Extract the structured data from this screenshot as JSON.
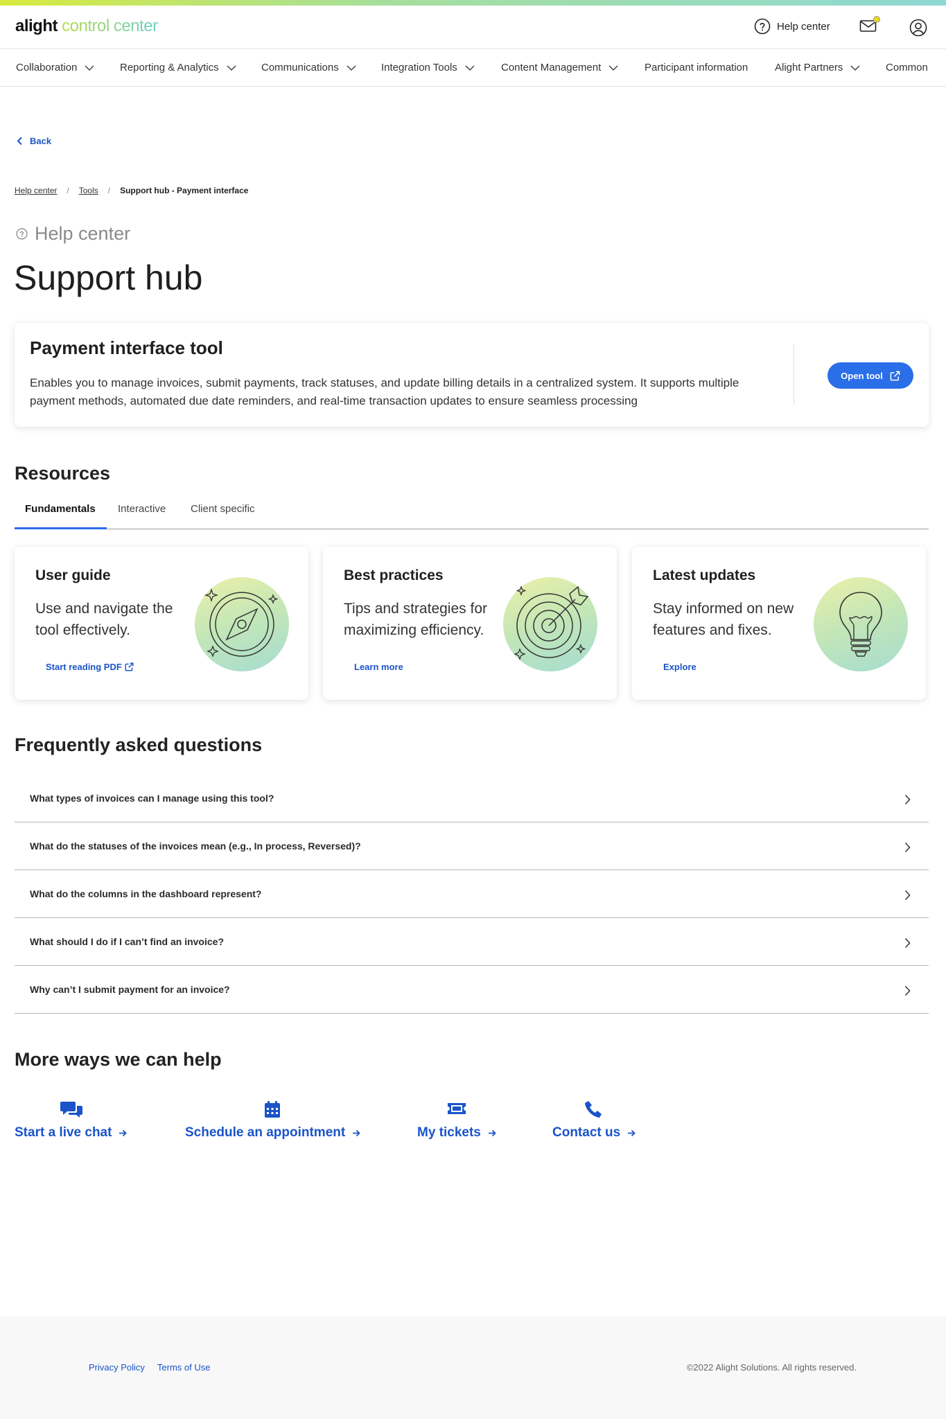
{
  "header": {
    "logo_brand": "alight",
    "logo_suffix": "control center",
    "help_label": "Help center"
  },
  "nav": {
    "items": [
      {
        "label": "Collaboration"
      },
      {
        "label": "Reporting & Analytics"
      },
      {
        "label": "Communications"
      },
      {
        "label": "Integration Tools"
      },
      {
        "label": "Content Management"
      },
      {
        "label": "Participant information"
      },
      {
        "label": "Alight Partners"
      },
      {
        "label": "Common"
      }
    ]
  },
  "back_label": "Back",
  "breadcrumb": {
    "items": [
      "Help center",
      "Tools"
    ],
    "separator": "/",
    "current": "Support hub - Payment interface"
  },
  "eyebrow": "Help center",
  "page_title": "Support hub",
  "tool": {
    "title": "Payment interface tool",
    "description": "Enables you to manage invoices, submit payments, track statuses, and update billing details in a centralized system. It supports multiple payment methods, automated due date reminders, and real-time transaction updates to ensure seamless processing",
    "button_label": "Open tool"
  },
  "resources": {
    "heading": "Resources",
    "tabs": [
      {
        "label": "Fundamentals",
        "active": true
      },
      {
        "label": "Interactive"
      },
      {
        "label": "Client specific"
      }
    ],
    "cards": [
      {
        "title": "User guide",
        "description": "Use and navigate the tool effectively.",
        "link": "Start reading PDF",
        "icon": "compass-icon"
      },
      {
        "title": "Best practices",
        "description": "Tips and strategies for maximizing efficiency.",
        "link": "Learn more",
        "icon": "target-icon"
      },
      {
        "title": "Latest updates",
        "description": "Stay informed on new features and fixes.",
        "link": "Explore",
        "icon": "lightbulb-icon"
      }
    ]
  },
  "faq": {
    "heading": "Frequently asked questions",
    "questions": [
      "What types of invoices can I manage using this tool?",
      "What do the statuses of the invoices mean (e.g., In process, Reversed)?",
      "What do the columns in the dashboard represent?",
      "What should I do if I can’t find an invoice?",
      "Why can’t I submit payment for an invoice?"
    ]
  },
  "more_help": {
    "heading": "More ways we can help",
    "options": [
      {
        "label": "Start a live chat",
        "icon": "chat-icon"
      },
      {
        "label": "Schedule an appointment",
        "icon": "calendar-icon"
      },
      {
        "label": "My tickets",
        "icon": "ticket-icon"
      },
      {
        "label": "Contact us",
        "icon": "phone-icon"
      }
    ]
  },
  "footer": {
    "links": [
      "Privacy Policy",
      "Terms of Use"
    ],
    "copyright": "©2022 Alight Solutions. All rights reserved."
  },
  "colors": {
    "accent": "#2a6ee8",
    "link": "#1a54c9"
  }
}
